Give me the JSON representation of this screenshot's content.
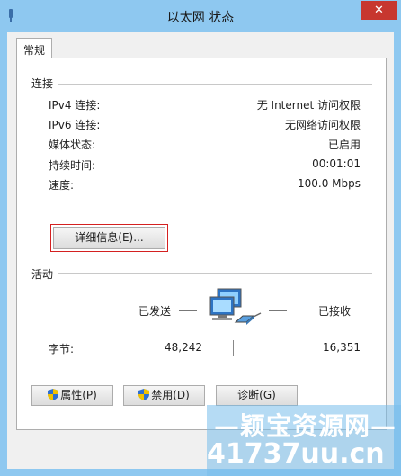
{
  "window": {
    "title": "以太网 状态",
    "close_label": "✕"
  },
  "tabs": [
    {
      "label": "常规"
    }
  ],
  "connection": {
    "section_label": "连接",
    "rows": [
      {
        "label": "IPv4 连接:",
        "value": "无 Internet 访问权限"
      },
      {
        "label": "IPv6 连接:",
        "value": "无网络访问权限"
      },
      {
        "label": "媒体状态:",
        "value": "已启用"
      },
      {
        "label": "持续时间:",
        "value": "00:01:01"
      },
      {
        "label": "速度:",
        "value": "100.0 Mbps"
      }
    ],
    "details_button": "详细信息(E)..."
  },
  "activity": {
    "section_label": "活动",
    "sent_label": "已发送",
    "received_label": "已接收",
    "bytes_label": "字节:",
    "bytes_sent": "48,242",
    "bytes_received": "16,351"
  },
  "buttons": {
    "properties": "属性(P)",
    "disable": "禁用(D)",
    "diagnose": "诊断(G)"
  },
  "watermark": {
    "line1": "—颖宝资源网—",
    "line2": "41737uu.cn"
  },
  "colors": {
    "frame": "#8ec8f0",
    "close": "#c7372f",
    "highlight": "#d42020"
  }
}
